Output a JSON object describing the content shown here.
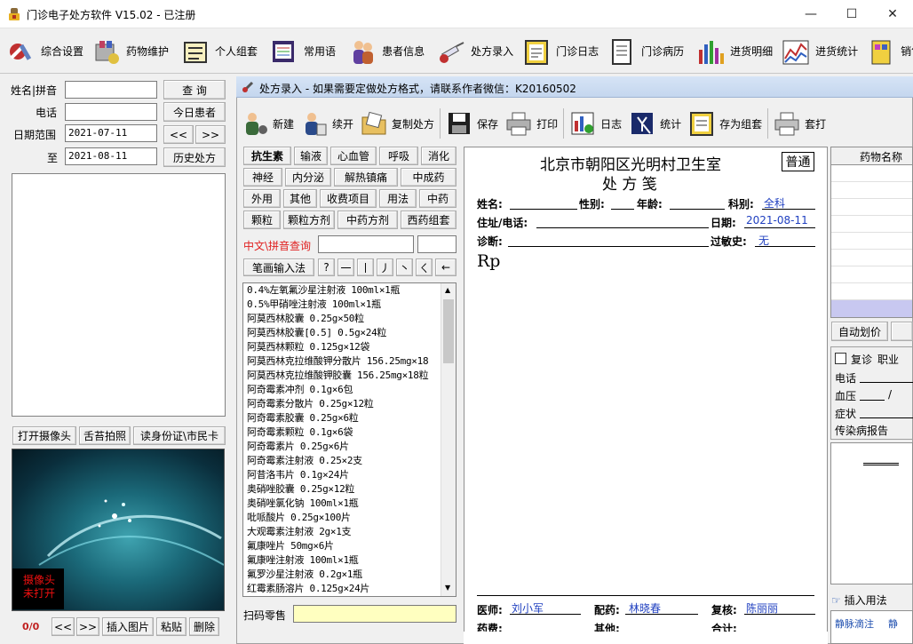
{
  "window": {
    "title": "门诊电子处方软件  V15.02  - 已注册",
    "minimize": "—",
    "maximize": "☐",
    "close": "✕"
  },
  "toolbar": [
    {
      "label": "综合设置",
      "icon": "settings-tools-icon"
    },
    {
      "label": "药物维护",
      "icon": "medicine-pills-icon"
    },
    {
      "label": "个人组套",
      "icon": "notebook-icon"
    },
    {
      "label": "常用语",
      "icon": "notepad-pen-icon"
    },
    {
      "label": "患者信息",
      "icon": "people-icon"
    },
    {
      "label": "处方录入",
      "icon": "syringe-icon"
    },
    {
      "label": "门诊日志",
      "icon": "clipboard-icon"
    },
    {
      "label": "门诊病历",
      "icon": "document-icon"
    },
    {
      "label": "进货明细",
      "icon": "bar-chart-icon"
    },
    {
      "label": "进货统计",
      "icon": "line-chart-icon"
    },
    {
      "label": "销售",
      "icon": "sales-icon"
    }
  ],
  "search": {
    "name_label": "姓名|拼音",
    "phone_label": "电话",
    "date_label": "日期范围",
    "to_label": "至",
    "date_from": "2021-07-11",
    "date_to": "2021-08-11",
    "query_btn": "查  询",
    "today_btn": "今日患者",
    "prev_btn": "<<",
    "next_btn": ">>",
    "history_btn": "历史处方"
  },
  "camera": {
    "open_btn": "打开摄像头",
    "tongue_btn": "舌苔拍照",
    "id_btn": "读身份证\\市民卡",
    "status": "摄像头\n未打开"
  },
  "bottom_left": {
    "counter": "0/0",
    "prev": "<<",
    "next": ">>",
    "insert_img": "插入图片",
    "paste": "粘贴",
    "delete": "删除"
  },
  "rx": {
    "header": "处方录入 - 如果需要定做处方格式，请联系作者微信：K20160502",
    "tools": [
      {
        "label": "新建",
        "icon": "new-icon"
      },
      {
        "label": "续开",
        "icon": "continue-icon"
      },
      {
        "label": "复制处方",
        "icon": "folder-copy-icon"
      },
      {
        "label": "保存",
        "icon": "floppy-icon"
      },
      {
        "label": "打印",
        "icon": "printer-icon"
      },
      {
        "label": "日志",
        "icon": "log-chart-icon"
      },
      {
        "label": "统计",
        "icon": "statistics-icon"
      },
      {
        "label": "存为组套",
        "icon": "save-group-icon"
      },
      {
        "label": "套打",
        "icon": "printer2-icon"
      }
    ],
    "categories": [
      [
        "抗生素",
        "输液",
        "心血管",
        "呼吸",
        "消化"
      ],
      [
        "神经",
        "内分泌",
        "解热镇痛",
        "中成药"
      ],
      [
        "外用",
        "其他",
        "收费项目",
        "用法",
        "中药"
      ],
      [
        "颗粒",
        "颗粒方剂",
        "中药方剂",
        "西药组套"
      ]
    ],
    "search_label": "中文\\拼音查询",
    "stroke_btn": "笔画输入法",
    "strokes": [
      "?",
      "一",
      "丨",
      "丿",
      "丶",
      "ㄑ",
      "←"
    ],
    "scan_label": "扫码零售",
    "drugs": [
      "0.4%左氧氟沙星注射液 100ml×1瓶",
      "0.5%甲硝唑注射液 100ml×1瓶",
      "阿莫西林胶囊 0.25g×50粒",
      "阿莫西林胶囊[0.5] 0.5g×24粒",
      "阿莫西林颗粒 0.125g×12袋",
      "阿莫西林克拉维酸钾分散片 156.25mg×18",
      "阿莫西林克拉维酸钾胶囊 156.25mg×18粒",
      "阿奇霉素冲剂 0.1g×6包",
      "阿奇霉素分散片 0.25g×12粒",
      "阿奇霉素胶囊 0.25g×6粒",
      "阿奇霉素颗粒 0.1g×6袋",
      "阿奇霉素片 0.25g×6片",
      "阿奇霉素注射液 0.25×2支",
      "阿昔洛韦片 0.1g×24片",
      "奥硝唑胶囊 0.25g×12粒",
      "奥硝唑氯化钠 100ml×1瓶",
      "吡哌酸片 0.25g×100片",
      "大观霉素注射液 2g×1支",
      "氟康唑片 50mg×6片",
      "氟康唑注射液 100ml×1瓶",
      "氟罗沙星注射液 0.2g×1瓶",
      "红霉素肠溶片 0.125g×24片"
    ]
  },
  "paper": {
    "clinic": "北京市朝阳区光明村卫生室",
    "type_badge": "普通",
    "title": "处  方  笺",
    "name_l": "姓名:",
    "sex_l": "性别:",
    "age_l": "年龄:",
    "dept_l": "科别:",
    "dept_v": "全科",
    "addr_l": "住址/电话:",
    "date_l": "日期:",
    "date_v": "2021-08-11",
    "diag_l": "诊断:",
    "allergy_l": "过敏史:",
    "allergy_v": "无",
    "rp": "Rp",
    "doctor_l": "医师:",
    "doctor_v": "刘小军",
    "dispense_l": "配药:",
    "dispense_v": "林晓春",
    "review_l": "复核:",
    "review_v": "陈丽丽",
    "fee_l": "药费:",
    "other_l": "其他:",
    "total_l": "合计:"
  },
  "right": {
    "drug_name_header": "药物名称",
    "auto_price": "自动划价",
    "revisit": "复诊",
    "occupation": "职业",
    "phone": "电话",
    "bp": "血压",
    "bp_sep": "/",
    "symptom": "症状",
    "report": "传染病报告",
    "insert_usage": "插入用法",
    "line1": "静脉滴注",
    "line2": "静"
  }
}
